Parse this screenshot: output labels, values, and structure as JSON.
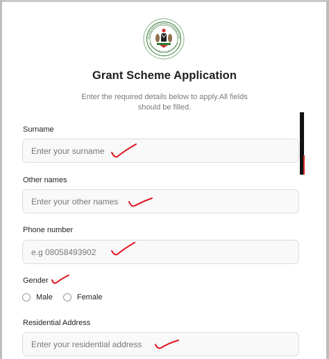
{
  "header": {
    "seal_icon": "coat-of-arms-seal",
    "title": "Grant Scheme Application",
    "subtitle": "Enter the required details below to apply.All fields should be filled."
  },
  "form": {
    "surname": {
      "label": "Surname",
      "placeholder": "Enter your surname",
      "value": ""
    },
    "other_names": {
      "label": "Other names",
      "placeholder": "Enter your other names",
      "value": ""
    },
    "phone": {
      "label": "Phone number",
      "placeholder": "e.g 08058493902",
      "value": ""
    },
    "gender": {
      "label": "Gender",
      "options": [
        {
          "label": "Male",
          "selected": false
        },
        {
          "label": "Female",
          "selected": false
        }
      ]
    },
    "address": {
      "label": "Residential Address",
      "placeholder": "Enter your residential address",
      "value": ""
    }
  },
  "colors": {
    "accent_seal_green": "#2e7d32",
    "annotation_red": "#e0141e",
    "field_border": "#dcdcdc"
  }
}
